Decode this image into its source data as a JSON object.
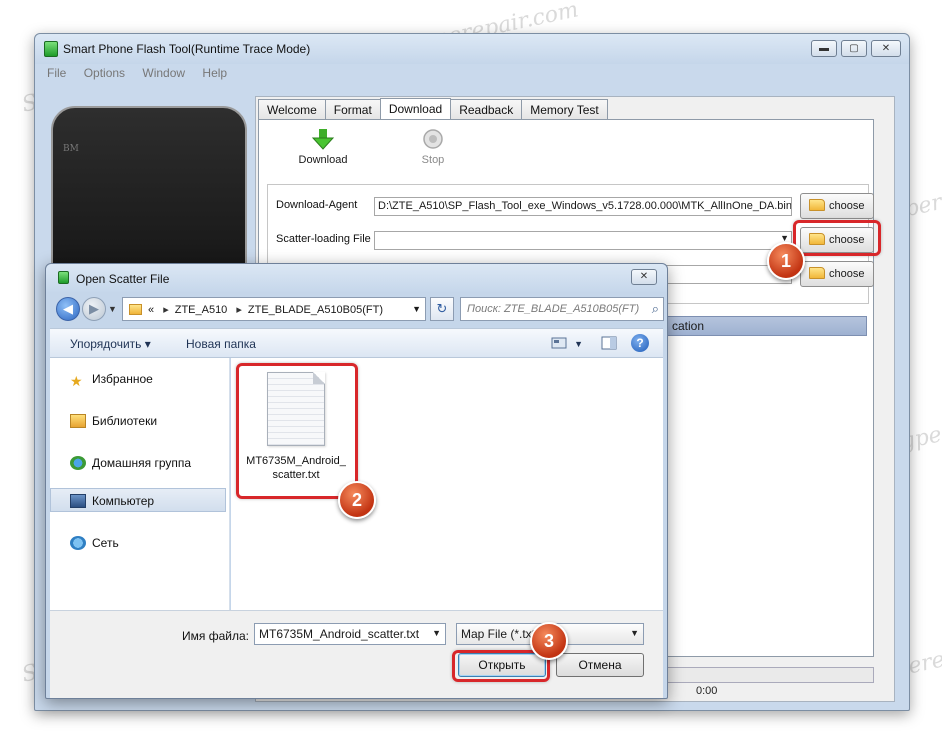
{
  "main_window": {
    "title": "Smart Phone Flash Tool(Runtime Trace Mode)",
    "controls": {
      "minimize": "▬",
      "maximize": "▢",
      "close": "✕"
    },
    "menu": [
      "File",
      "Options",
      "Window",
      "Help"
    ],
    "phone_brand": "BM",
    "tabs": [
      "Welcome",
      "Format",
      "Download",
      "Readback",
      "Memory Test"
    ],
    "active_tab": "Download",
    "toolbar": {
      "download_label": "Download",
      "stop_label": "Stop"
    },
    "fields": {
      "download_agent_label": "Download-Agent",
      "download_agent_value": "D:\\ZTE_A510\\SP_Flash_Tool_exe_Windows_v5.1728.00.000\\MTK_AllInOne_DA.bin",
      "scatter_label": "Scatter-loading File",
      "scatter_value": "",
      "third_value": ""
    },
    "choose_label": "choose",
    "location_header": "cation",
    "status_time": "0:00"
  },
  "dialog": {
    "title": "Open Scatter File",
    "close": "✕",
    "address": {
      "overflow": "«",
      "crumbs": [
        "ZTE_A510",
        "ZTE_BLADE_A510B05(FT)"
      ],
      "search_placeholder": "Поиск: ZTE_BLADE_A510B05(FT)"
    },
    "command_bar": {
      "organize": "Упорядочить ▾",
      "new_folder": "Новая папка"
    },
    "nav": [
      {
        "label": "Избранное",
        "icon": "star-icon"
      },
      {
        "label": "Библиотеки",
        "icon": "library-icon"
      },
      {
        "label": "Домашняя группа",
        "icon": "homegroup-icon"
      },
      {
        "label": "Компьютер",
        "icon": "computer-icon"
      },
      {
        "label": "Сеть",
        "icon": "network-icon"
      }
    ],
    "file": {
      "name": "MT6735M_Android_scatter.txt",
      "icon": "text-file-icon"
    },
    "filename_label": "Имя файла:",
    "filename_value": "MT6735M_Android_scatter.txt",
    "filetype_value": "Map File (*.txt)",
    "open_label": "Открыть",
    "cancel_label": "Отмена"
  },
  "annotations": {
    "badge1": "1",
    "badge2": "2",
    "badge3": "3",
    "highlight_color": "#d8272a"
  },
  "watermark": "Soringperepair.com"
}
